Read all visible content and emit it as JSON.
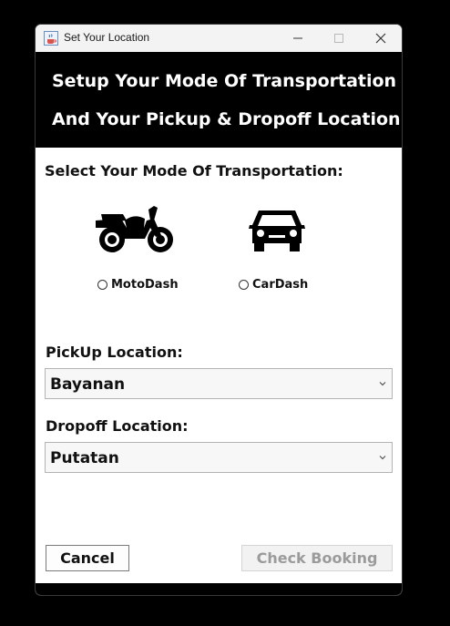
{
  "window": {
    "title": "Set Your Location",
    "icons": {
      "app": "java-cup-icon",
      "minimize": "minimize-icon",
      "maximize": "maximize-icon",
      "close": "close-icon"
    }
  },
  "header": {
    "line1": "Setup Your Mode Of Transportation",
    "line2": "And Your Pickup & Dropoff Location"
  },
  "transport": {
    "label": "Select Your Mode Of Transportation:",
    "options": [
      {
        "label": "MotoDash",
        "icon": "motorcycle-icon",
        "selected": false
      },
      {
        "label": "CarDash",
        "icon": "car-icon",
        "selected": false
      }
    ]
  },
  "pickup": {
    "label": "PickUp Location:",
    "value": "Bayanan"
  },
  "dropoff": {
    "label": "Dropoff Location:",
    "value": "Putatan"
  },
  "buttons": {
    "cancel": "Cancel",
    "check": "Check Booking",
    "check_enabled": false
  },
  "colors": {
    "header_bg": "#000000",
    "header_text": "#ffffff",
    "disabled_text": "#9b9b9b"
  }
}
